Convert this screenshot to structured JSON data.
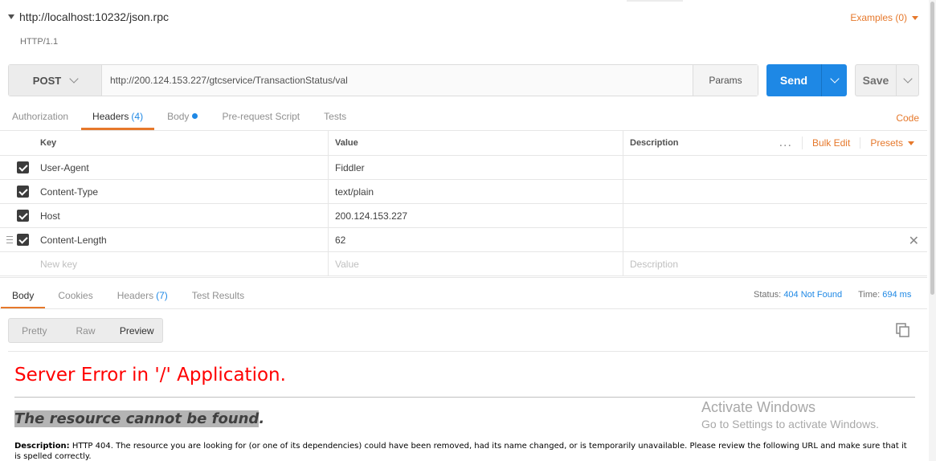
{
  "request": {
    "title": "http://localhost:10232/json.rpc",
    "http_version": "HTTP/1.1",
    "examples_label": "Examples (0)"
  },
  "url_bar": {
    "method": "POST",
    "url": "http://200.124.153.227/gtcservice/TransactionStatus/val",
    "params_label": "Params",
    "send_label": "Send",
    "save_label": "Save"
  },
  "request_tabs": {
    "authorization": "Authorization",
    "headers": "Headers",
    "headers_count": "(4)",
    "body": "Body",
    "prerequest": "Pre-request Script",
    "tests": "Tests",
    "code": "Code"
  },
  "headers_table": {
    "col_key": "Key",
    "col_value": "Value",
    "col_description": "Description",
    "more_icon": "...",
    "bulk_edit": "Bulk Edit",
    "presets": "Presets",
    "rows": [
      {
        "key": "User-Agent",
        "value": "Fiddler",
        "checked": true
      },
      {
        "key": "Content-Type",
        "value": "text/plain",
        "checked": true
      },
      {
        "key": "Host",
        "value": "200.124.153.227",
        "checked": true
      },
      {
        "key": "Content-Length",
        "value": "62",
        "checked": true
      }
    ],
    "new_key_placeholder": "New key",
    "value_placeholder": "Value",
    "description_placeholder": "Description"
  },
  "response_tabs": {
    "body": "Body",
    "cookies": "Cookies",
    "headers": "Headers",
    "headers_count": "(7)",
    "test_results": "Test Results"
  },
  "status": {
    "status_label": "Status:",
    "status_value": "404 Not Found",
    "time_label": "Time:",
    "time_value": "694 ms"
  },
  "view_modes": {
    "pretty": "Pretty",
    "raw": "Raw",
    "preview": "Preview"
  },
  "preview": {
    "error_title": "Server Error in '/' Application.",
    "error_subtitle": "The resource cannot be found",
    "error_subtitle_suffix": ".",
    "description_label": "Description:",
    "description_text": "HTTP 404. The resource you are looking for (or one of its dependencies) could have been removed, had its name changed, or is temporarily unavailable.  Please review the following URL and make sure that it is spelled correctly."
  },
  "watermark": {
    "line1": "Activate Windows",
    "line2": "Go to Settings to activate Windows."
  },
  "colors": {
    "accent_orange": "#e6782b",
    "accent_blue": "#1e88e5",
    "error_red": "#ff0000"
  }
}
